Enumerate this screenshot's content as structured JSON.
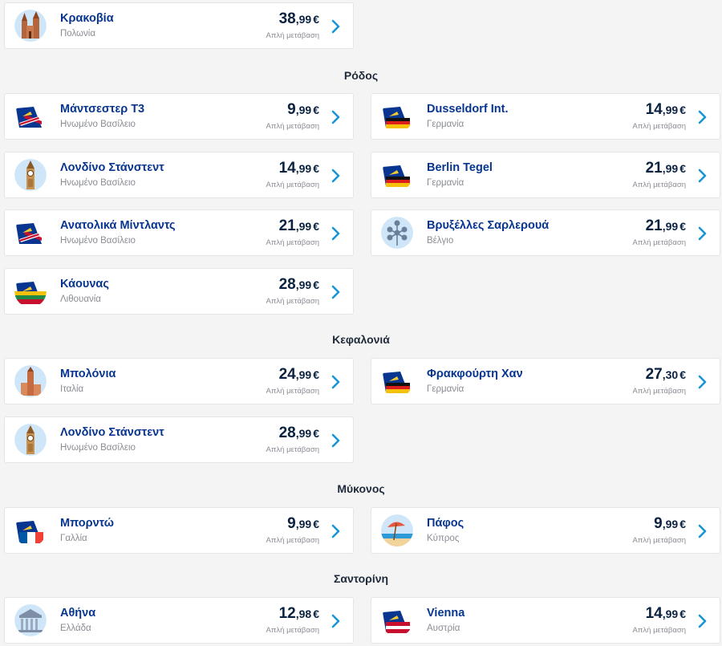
{
  "labels": {
    "direct": "Απλή μετάβαση",
    "currency": "€"
  },
  "colors": {
    "primary": "#073590",
    "accent": "#1895d6",
    "price": "#0a2240"
  },
  "top": [
    {
      "city": "Κρακοβία",
      "country": "Πολωνία",
      "int": "38",
      "dec": ",99",
      "icon": "church-icon"
    }
  ],
  "sections": [
    {
      "title": "Ρόδος",
      "left": [
        {
          "city": "Μάντσεστερ T3",
          "country": "Ηνωμένο Βασίλειο",
          "int": "9",
          "dec": ",99",
          "icon": "uk-flag-tail-icon"
        },
        {
          "city": "Λονδίνο Στάνστεντ",
          "country": "Ηνωμένο Βασίλειο",
          "int": "14",
          "dec": ",99",
          "icon": "big-ben-icon"
        },
        {
          "city": "Ανατολικά Μίντλαντς",
          "country": "Ηνωμένο Βασίλειο",
          "int": "21",
          "dec": ",99",
          "icon": "uk-flag-tail-icon"
        },
        {
          "city": "Κάουνας",
          "country": "Λιθουανία",
          "int": "28",
          "dec": ",99",
          "icon": "lithuania-flag-tail-icon"
        }
      ],
      "right": [
        {
          "city": "Dusseldorf Int.",
          "country": "Γερμανία",
          "int": "14",
          "dec": ",99",
          "icon": "germany-flag-tail-icon"
        },
        {
          "city": "Berlin Tegel",
          "country": "Γερμανία",
          "int": "21",
          "dec": ",99",
          "icon": "germany-flag-tail-icon"
        },
        {
          "city": "Βρυξέλλες Σαρλερουά",
          "country": "Βέλγιο",
          "int": "21",
          "dec": ",99",
          "icon": "atomium-icon"
        }
      ]
    },
    {
      "title": "Κεφαλονιά",
      "left": [
        {
          "city": "Μπολόνια",
          "country": "Ιταλία",
          "int": "24",
          "dec": ",99",
          "icon": "tower-icon"
        },
        {
          "city": "Λονδίνο Στάνστεντ",
          "country": "Ηνωμένο Βασίλειο",
          "int": "28",
          "dec": ",99",
          "icon": "big-ben-icon"
        }
      ],
      "right": [
        {
          "city": "Φρακφούρτη Χαν",
          "country": "Γερμανία",
          "int": "27",
          "dec": ",30",
          "icon": "germany-flag-tail-icon"
        }
      ]
    },
    {
      "title": "Μύκονος",
      "left": [
        {
          "city": "Μπορντώ",
          "country": "Γαλλία",
          "int": "9",
          "dec": ",99",
          "icon": "france-flag-tail-icon"
        }
      ],
      "right": [
        {
          "city": "Πάφος",
          "country": "Κύπρος",
          "int": "9",
          "dec": ",99",
          "icon": "beach-icon"
        }
      ]
    },
    {
      "title": "Σαντορίνη",
      "left": [
        {
          "city": "Αθήνα",
          "country": "Ελλάδα",
          "int": "12",
          "dec": ",98",
          "icon": "parthenon-icon"
        }
      ],
      "right": [
        {
          "city": "Vienna",
          "country": "Αυστρία",
          "int": "14",
          "dec": ",99",
          "icon": "austria-flag-tail-icon"
        }
      ]
    }
  ]
}
